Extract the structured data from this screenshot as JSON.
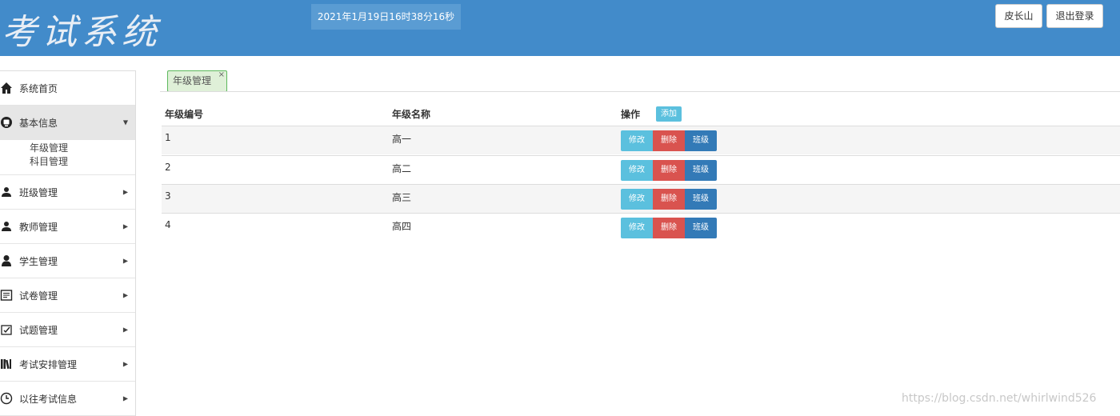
{
  "header": {
    "title": "考试系统",
    "clock": "2021年1月19日16时38分16秒",
    "user_button": "皮长山",
    "logout_button": "退出登录",
    "bg_color": "#428bca"
  },
  "sidebar": {
    "home": {
      "label": "系统首页",
      "icon": "home-icon"
    },
    "basic": {
      "label": "基本信息",
      "icon": "info-icon",
      "caret": "▼",
      "expanded": true,
      "sub": [
        "年级管理",
        "科目管理"
      ]
    },
    "items": [
      {
        "label": "班级管理",
        "icon": "users-icon",
        "caret": "▶"
      },
      {
        "label": "教师管理",
        "icon": "teacher-icon",
        "caret": "▶"
      },
      {
        "label": "学生管理",
        "icon": "student-icon",
        "caret": "▶"
      },
      {
        "label": "试卷管理",
        "icon": "paper-icon",
        "caret": "▶"
      },
      {
        "label": "试题管理",
        "icon": "question-icon",
        "caret": "▶"
      },
      {
        "label": "考试安排管理",
        "icon": "books-icon",
        "caret": "▶"
      },
      {
        "label": "以往考试信息",
        "icon": "clock-icon",
        "caret": "▶"
      }
    ]
  },
  "tab": {
    "label": "年级管理",
    "close": "×"
  },
  "table": {
    "headers": {
      "id": "年级编号",
      "name": "年级名称",
      "ops": "操作"
    },
    "add_button": "添加",
    "actions": {
      "edit": "修改",
      "delete": "删除",
      "class": "班级"
    },
    "rows": [
      {
        "id": "1",
        "name": "高一"
      },
      {
        "id": "2",
        "name": "高二"
      },
      {
        "id": "3",
        "name": "高三"
      },
      {
        "id": "4",
        "name": "高四"
      }
    ]
  },
  "watermark": "https://blog.csdn.net/whirlwind526"
}
